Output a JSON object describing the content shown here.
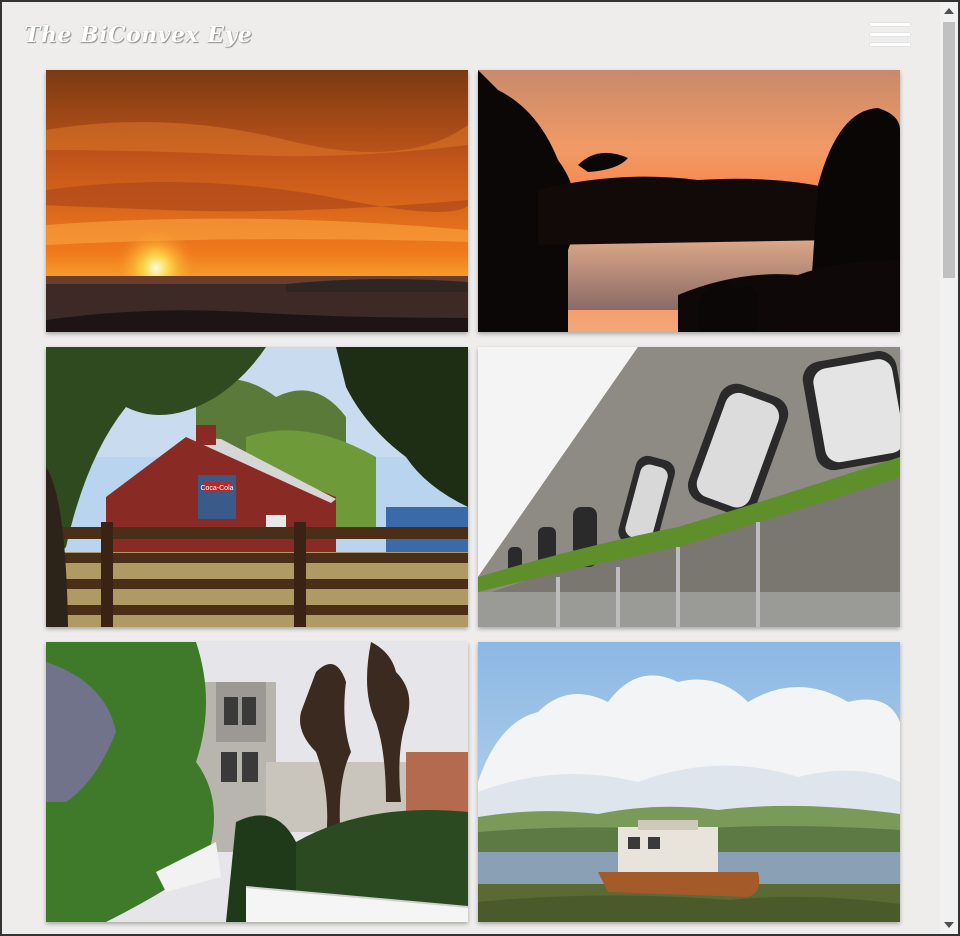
{
  "site": {
    "title": "The BiConvex Eye",
    "menu_icon": "hamburger-menu-icon"
  },
  "gallery": {
    "photos": [
      {
        "name": "photo-ocean-sunset",
        "subject": "sunset over the ocean"
      },
      {
        "name": "photo-lagoon-silhouette",
        "subject": "lagoon at dusk with tree silhouettes"
      },
      {
        "name": "photo-red-barn",
        "subject": "red barn with Coca-Cola sign behind a wooden fence"
      },
      {
        "name": "photo-rusted-windows",
        "subject": "weathered hull windows with moss"
      },
      {
        "name": "photo-victorian-houses",
        "subject": "wisteria, houses and pruned trees"
      },
      {
        "name": "photo-shipwreck",
        "subject": "stranded boat on marsh under clouds"
      }
    ]
  },
  "barn_sign": "Coca-Cola",
  "colors": {
    "page_background": "#eeedec",
    "title_text": "#ffffff"
  },
  "scrollbar": {
    "position_fraction": 0.0
  }
}
